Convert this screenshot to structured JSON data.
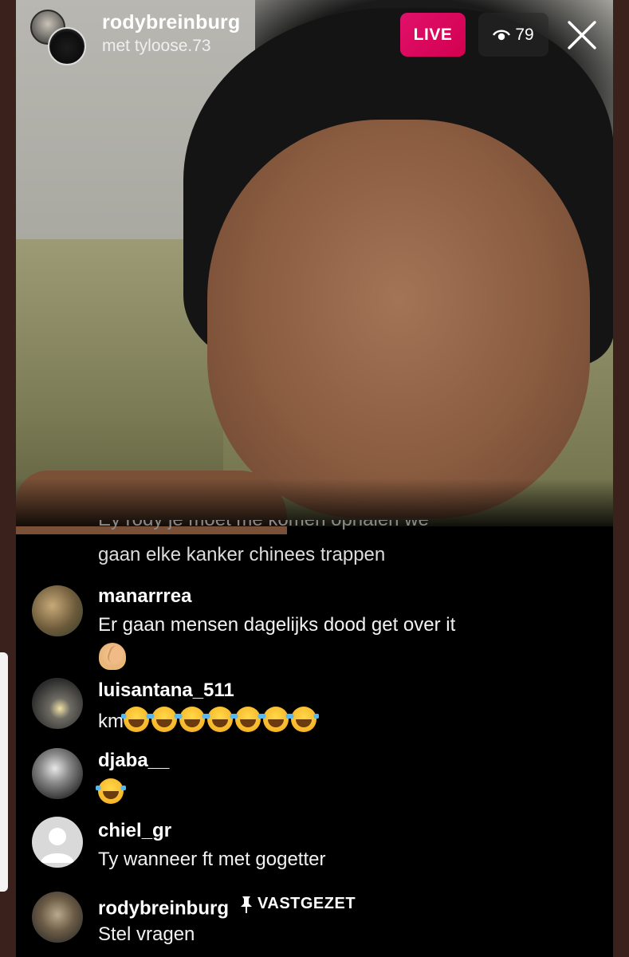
{
  "header": {
    "host_name": "rodybreinburg",
    "guest_label": "met tyloose.73",
    "live_label": "LIVE",
    "viewer_count": "79"
  },
  "comments": {
    "truncated_line": "Ey rody je moet me komen ophalen we",
    "first_text": "gaan elke kanker chinees trappen",
    "items": [
      {
        "user": "manarrrea",
        "text": "Er gaan mensen dagelijks dood get over it",
        "emoji": "woman-facepalming"
      },
      {
        "user": "luisantana_511",
        "text": "km",
        "emoji": "face-with-tears-of-joy x7"
      },
      {
        "user": "djaba__",
        "text": "",
        "emoji": "face-with-tears-of-joy"
      },
      {
        "user": "chiel_gr",
        "text": "Ty wanneer ft met gogetter"
      },
      {
        "user": "rodybreinburg",
        "pin_label": "VASTGEZET",
        "text": "Stel vragen"
      }
    ]
  },
  "colors": {
    "live_badge": "#d3004f",
    "background": "#000000",
    "frame": "#3a211c"
  }
}
